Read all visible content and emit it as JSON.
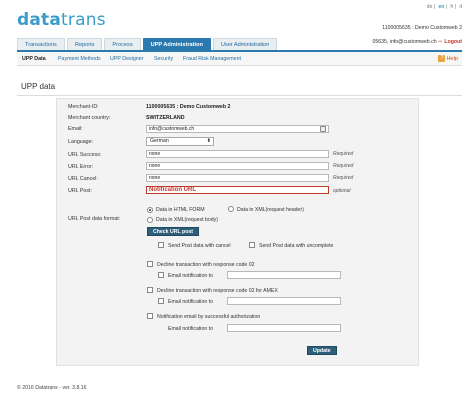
{
  "brand": {
    "logo_a": "data",
    "logo_b": "trans"
  },
  "languages": [
    "de",
    "en",
    "fr",
    "it"
  ],
  "active_language": "en",
  "merchant_header": "1100005635 : Demo Customweb 2",
  "user": {
    "line": "05635, info@customweb.ch",
    "logout": "Logout"
  },
  "tabs": [
    {
      "label": "Transactions",
      "active": false
    },
    {
      "label": "Reports",
      "active": false
    },
    {
      "label": "Process",
      "active": false
    },
    {
      "label": "UPP Administration",
      "active": true
    },
    {
      "label": "User Administration",
      "active": false
    }
  ],
  "subnav": [
    {
      "label": "UPP Data",
      "active": true
    },
    {
      "label": "Payment Methods",
      "active": false
    },
    {
      "label": "UPP Designer",
      "active": false
    },
    {
      "label": "Security",
      "active": false
    },
    {
      "label": "Fraud Risk Management",
      "active": false
    }
  ],
  "help_label": "Help",
  "page_title": "UPP data",
  "form": {
    "merchant_id_label": "Merchant-ID:",
    "merchant_id_value": "1100005635 : Demo Customweb 2",
    "merchant_country_label": "Merchant country:",
    "merchant_country_value": "SWITZERLAND",
    "email_label": "Email:",
    "email_value": "info@customweb.ch",
    "language_label": "Language:",
    "language_value": "German",
    "url_success_label": "URL Success:",
    "url_success_value": "none",
    "url_error_label": "URL Error:",
    "url_error_value": "none",
    "url_cancel_label": "URL Cancel:",
    "url_cancel_value": "none",
    "url_post_label": "URL Post:",
    "url_post_value": "Notification URL",
    "required": "Required",
    "optional": "optional",
    "post_format_label": "URL Post data format:",
    "format_html": "Data in HTML FORM",
    "format_xml_header": "Data in XML(request header)",
    "format_xml_body": "Data in XML(request body)",
    "check_url_button": "Check URL post",
    "send_cancel": "Send Post data with cancel",
    "send_uncomplete": "Send Post data with uncomplete",
    "decline_02": "Decline transaction with response code 02",
    "email_notification_to": "Email notification to",
    "decline_02_amex": "Decline transaction with response code 02 for AMEX",
    "notify_success": "Notification email by successful authorization",
    "email_notification_to_plain": "Email notification to",
    "update_button": "Update"
  },
  "footer": "© 2016 Datatrans - ver. 3.8.16",
  "colors": {
    "brand": "#3a9cc8",
    "tab_active": "#2a7ab0",
    "logout": "#c0392b",
    "error": "#c0392b",
    "button": "#2d5f7a"
  }
}
